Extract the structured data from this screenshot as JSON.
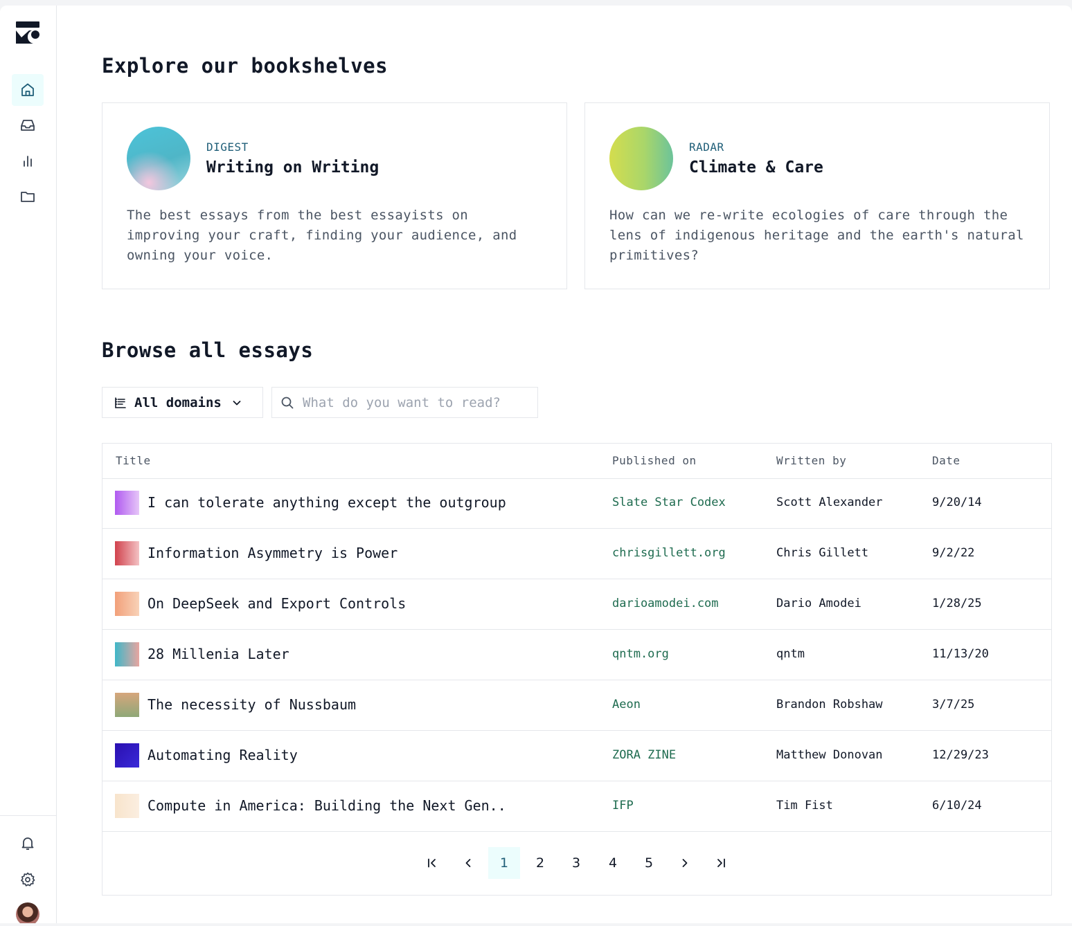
{
  "sidebar": {
    "nav": [
      {
        "icon": "home-icon",
        "active": true
      },
      {
        "icon": "inbox-icon",
        "active": false
      },
      {
        "icon": "bar-chart-icon",
        "active": false
      },
      {
        "icon": "folder-icon",
        "active": false
      }
    ],
    "bottom": [
      {
        "icon": "bell-icon"
      },
      {
        "icon": "gear-icon"
      }
    ]
  },
  "bookshelves": {
    "heading": "Explore our bookshelves",
    "cards": [
      {
        "kicker": "DIGEST",
        "title": "Writing on Writing",
        "description": "The best essays from the best essayists on improving your craft, finding your audience, and owning your voice."
      },
      {
        "kicker": "RADAR",
        "title": "Climate & Care",
        "description": "How can we re-write ecologies of care through the lens of indigenous heritage and the earth's natural primitives?"
      }
    ]
  },
  "essays": {
    "heading": "Browse all essays",
    "filter_label": "All domains",
    "search_placeholder": "What do you want to read?",
    "columns": {
      "title": "Title",
      "published": "Published on",
      "author": "Written by",
      "date": "Date"
    },
    "rows": [
      {
        "title": "I can tolerate anything except the outgroup",
        "published": "Slate Star Codex",
        "author": "Scott Alexander",
        "date": "9/20/14"
      },
      {
        "title": "Information Asymmetry is Power",
        "published": "chrisgillett.org",
        "author": "Chris Gillett",
        "date": "9/2/22"
      },
      {
        "title": "On DeepSeek and Export Controls",
        "published": "darioamodei.com",
        "author": "Dario Amodei",
        "date": "1/28/25"
      },
      {
        "title": "28 Millenia Later",
        "published": "qntm.org",
        "author": "qntm",
        "date": "11/13/20"
      },
      {
        "title": "The necessity of Nussbaum",
        "published": "Aeon",
        "author": "Brandon Robshaw",
        "date": "3/7/25"
      },
      {
        "title": "Automating Reality",
        "published": "ZORA ZINE",
        "author": "Matthew Donovan",
        "date": "12/29/23"
      },
      {
        "title": "Compute in America: Building the Next Gen..",
        "published": "IFP",
        "author": "Tim Fist",
        "date": "6/10/24"
      }
    ],
    "pagination": {
      "pages": [
        "1",
        "2",
        "3",
        "4",
        "5"
      ],
      "current": "1"
    }
  },
  "colors": {
    "accent": "#1f5e78",
    "link_green": "#1e6b4f",
    "active_bg": "#ecfdfd"
  }
}
